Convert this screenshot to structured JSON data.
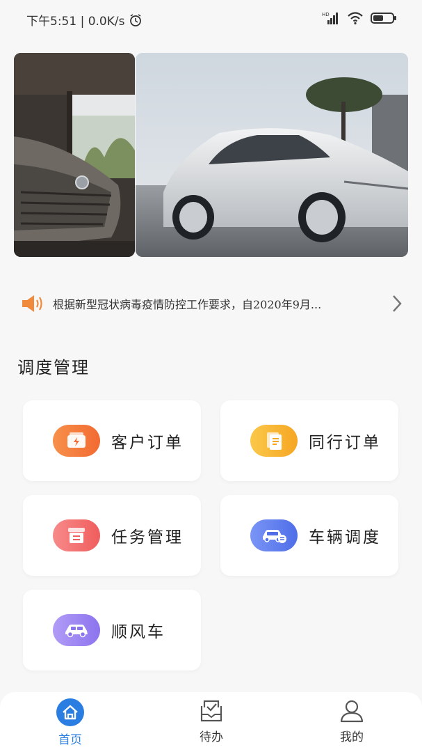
{
  "status_bar": {
    "time_text": "下午5:51 | 0.0K/s",
    "icons": [
      "alarm-icon",
      "hd-signal-icon",
      "wifi-icon",
      "battery-icon"
    ]
  },
  "banner": {
    "slides": [
      "banner-slide-front",
      "banner-slide-side"
    ]
  },
  "notice": {
    "text": "根据新型冠状病毒疫情防控工作要求，自2020年9月...",
    "icon": "speaker-icon"
  },
  "section": {
    "title": "调度管理"
  },
  "menu": [
    {
      "label": "客户订单",
      "icon": "wallet-icon",
      "color": "#f5793a"
    },
    {
      "label": "同行订单",
      "icon": "document-icon",
      "color": "#f7b42c"
    },
    {
      "label": "任务管理",
      "icon": "archive-icon",
      "color": "#f36b6b"
    },
    {
      "label": "车辆调度",
      "icon": "car-dispatch-icon",
      "color": "#5b7cf0"
    },
    {
      "label": "顺风车",
      "icon": "car-icon",
      "color": "#9b86f2"
    }
  ],
  "tabs": [
    {
      "label": "首页",
      "icon": "home-icon",
      "active": true
    },
    {
      "label": "待办",
      "icon": "todo-icon",
      "active": false
    },
    {
      "label": "我的",
      "icon": "user-icon",
      "active": false
    }
  ],
  "colors": {
    "accent": "#2a7de1",
    "background": "#f7f7f7"
  }
}
